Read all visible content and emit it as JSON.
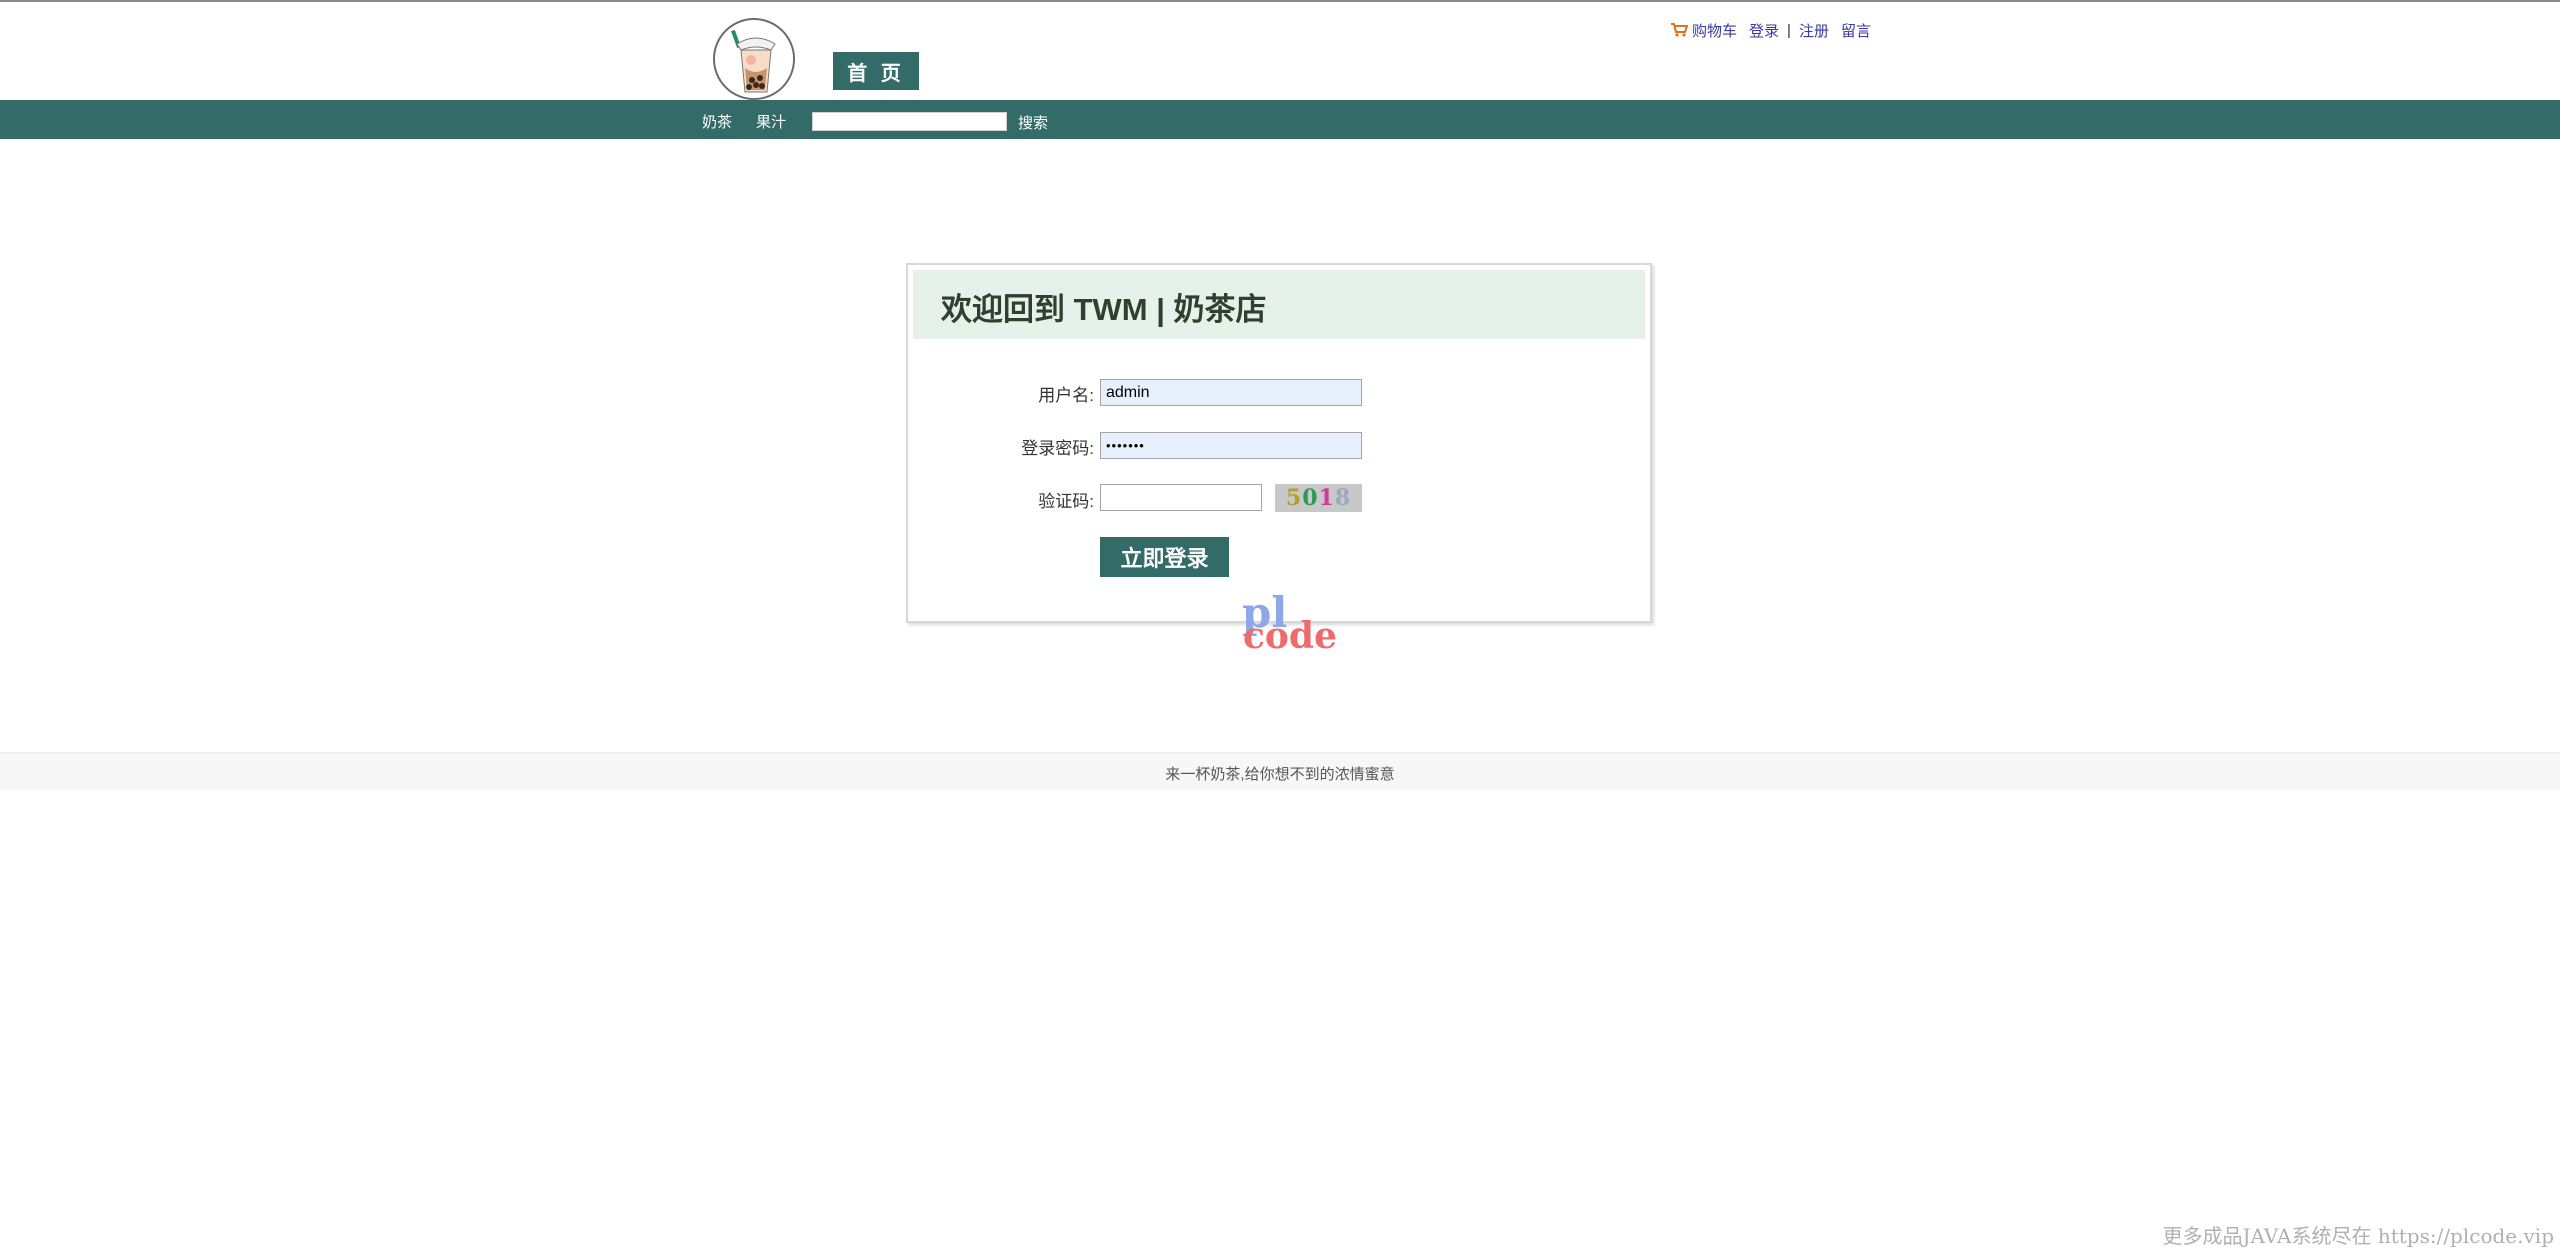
{
  "header": {
    "home_tab": "首 页",
    "links": {
      "cart": "购物车",
      "login": "登录",
      "separator": "|",
      "register": "注册",
      "message": "留言"
    }
  },
  "nav": {
    "items": [
      "奶茶",
      "果汁"
    ],
    "search_value": "",
    "search_button": "搜索"
  },
  "login": {
    "title": "欢迎回到 TWM | 奶茶店",
    "username_label": "用户名:",
    "username_value": "admin",
    "password_label": "登录密码:",
    "password_value": "•••••••",
    "captcha_label": "验证码:",
    "captcha_value": "",
    "captcha_digits": [
      "5",
      "0",
      "1",
      "8"
    ],
    "submit_label": "立即登录"
  },
  "watermark": {
    "brand_pl": "pl",
    "brand_code": "code",
    "bottom_text": "更多成品JAVA系统尽在 https://plcode.vip"
  },
  "footer": {
    "text": "来一杯奶茶,给你想不到的浓情蜜意"
  },
  "colors": {
    "brand_green": "#336b68",
    "login_header_bg": "#e6f2e9",
    "link_blue": "#3a3aa0"
  }
}
